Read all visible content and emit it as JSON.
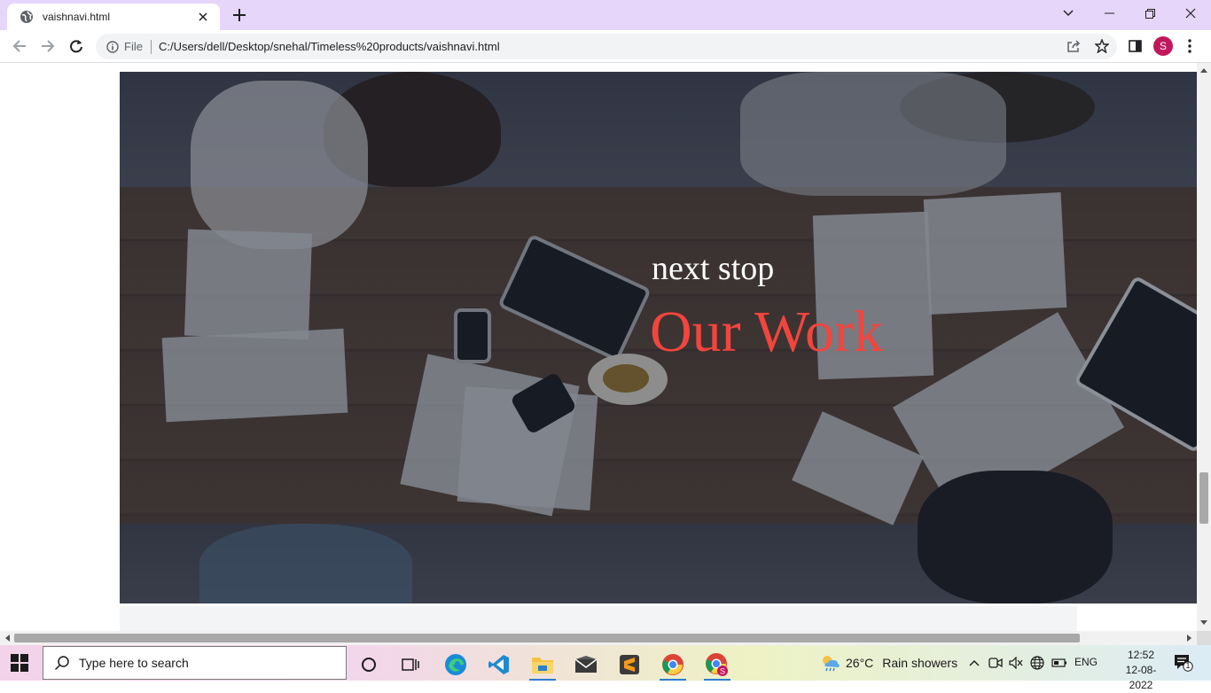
{
  "browser": {
    "tab_title": "vaishnavi.html",
    "site_info_label": "File",
    "url": "C:/Users/dell/Desktop/snehal/Timeless%20products/vaishnavi.html",
    "profile_initial": "S",
    "profile_color": "#c2185b"
  },
  "page": {
    "hero": {
      "subtitle": "next stop",
      "title": "Our Work",
      "title_color": "#f2453d",
      "subtitle_color": "#ffffff"
    }
  },
  "taskbar": {
    "search_placeholder": "Type here to search",
    "weather": {
      "temperature": "26°C",
      "description": "Rain showers"
    },
    "language": "ENG",
    "time": "12:52",
    "date": "12-08-2022",
    "notification_count": "1",
    "apps": [
      "task-view",
      "news-widget",
      "edge",
      "vscode",
      "file-explorer",
      "mail",
      "sublime-text",
      "chrome",
      "chrome-profile"
    ]
  }
}
